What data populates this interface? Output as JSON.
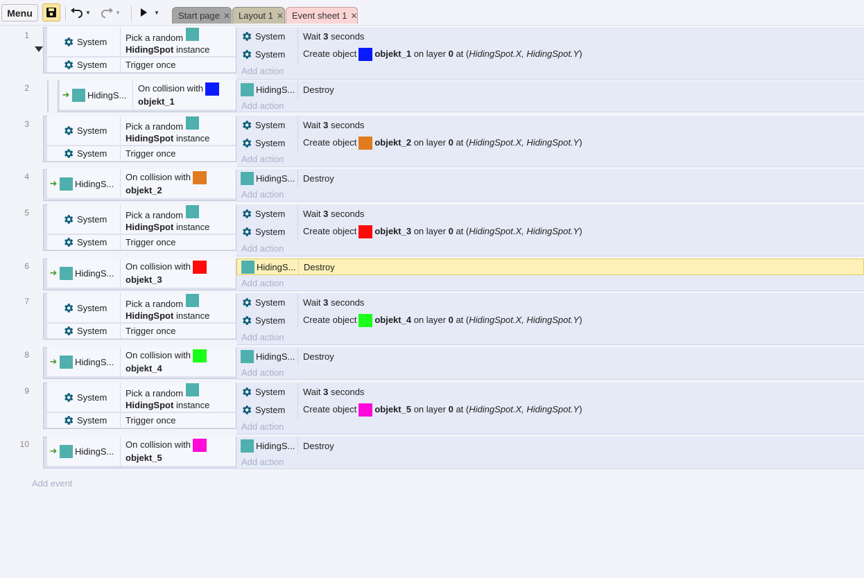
{
  "toolbar": {
    "menu_label": "Menu",
    "tabs": [
      {
        "label": "Start page"
      },
      {
        "label": "Layout 1"
      },
      {
        "label": "Event sheet 1"
      }
    ]
  },
  "colors": {
    "objekt_1": "#0a1aff",
    "objekt_2": "#e07b20",
    "objekt_3": "#ff0a0a",
    "objekt_4": "#1aff1a",
    "objekt_5": "#ff0ad8",
    "hidingspot_tile": "#4fb0ad"
  },
  "labels": {
    "system": "System",
    "pick_random": "Pick a random",
    "hidingspot": "HidingSpot",
    "instance": "instance",
    "trigger_once": "Trigger once",
    "hidings_short": "HidingS...",
    "on_collision": "On collision with",
    "wait": "Wait",
    "seconds": "seconds",
    "create_object": "Create object",
    "on_layer": "on layer",
    "at": "at (",
    "coords": "HidingSpot.X, HidingSpot.Y",
    "close_paren": ")",
    "destroy": "Destroy",
    "add_action": "Add action",
    "add_event": "Add event"
  },
  "events": [
    {
      "num": "1",
      "wait": "3",
      "object": "objekt_1",
      "layer": "0"
    },
    {
      "num": "2",
      "object": "objekt_1"
    },
    {
      "num": "3",
      "wait": "3",
      "object": "objekt_2",
      "layer": "0"
    },
    {
      "num": "4",
      "object": "objekt_2"
    },
    {
      "num": "5",
      "wait": "3",
      "object": "objekt_3",
      "layer": "0"
    },
    {
      "num": "6",
      "object": "objekt_3"
    },
    {
      "num": "7",
      "wait": "3",
      "object": "objekt_4",
      "layer": "0"
    },
    {
      "num": "8",
      "object": "objekt_4"
    },
    {
      "num": "9",
      "wait": "3",
      "object": "objekt_5",
      "layer": "0"
    },
    {
      "num": "10",
      "object": "objekt_5"
    }
  ]
}
